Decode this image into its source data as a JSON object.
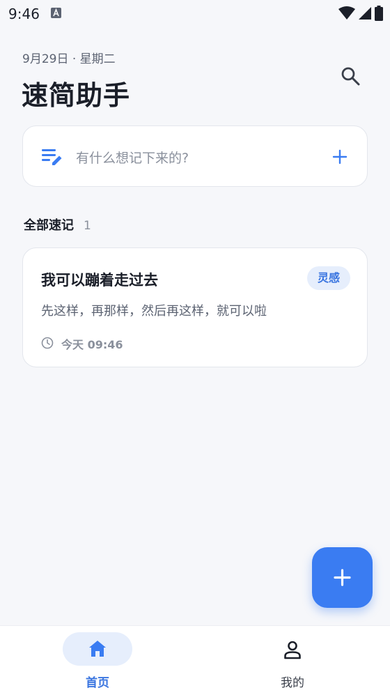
{
  "status_bar": {
    "time": "9:46"
  },
  "header": {
    "date": "9月29日 · 星期二",
    "title": "速简助手"
  },
  "quick_input": {
    "placeholder": "有什么想记下来的?"
  },
  "section": {
    "title": "全部速记",
    "count": "1"
  },
  "notes": [
    {
      "title": "我可以蹦着走过去",
      "tag": "灵感",
      "body": "先这样，再那样，然后再这样，就可以啦",
      "time": "今天 09:46"
    }
  ],
  "bottom_nav": {
    "home_label": "首页",
    "me_label": "我的"
  },
  "colors": {
    "accent": "#3a7cf2",
    "tag_bg": "#e6eefc",
    "background": "#f6f7fa"
  },
  "icons": [
    "search-icon",
    "note-edit-icon",
    "plus-icon",
    "clock-icon",
    "home-icon",
    "person-icon"
  ]
}
